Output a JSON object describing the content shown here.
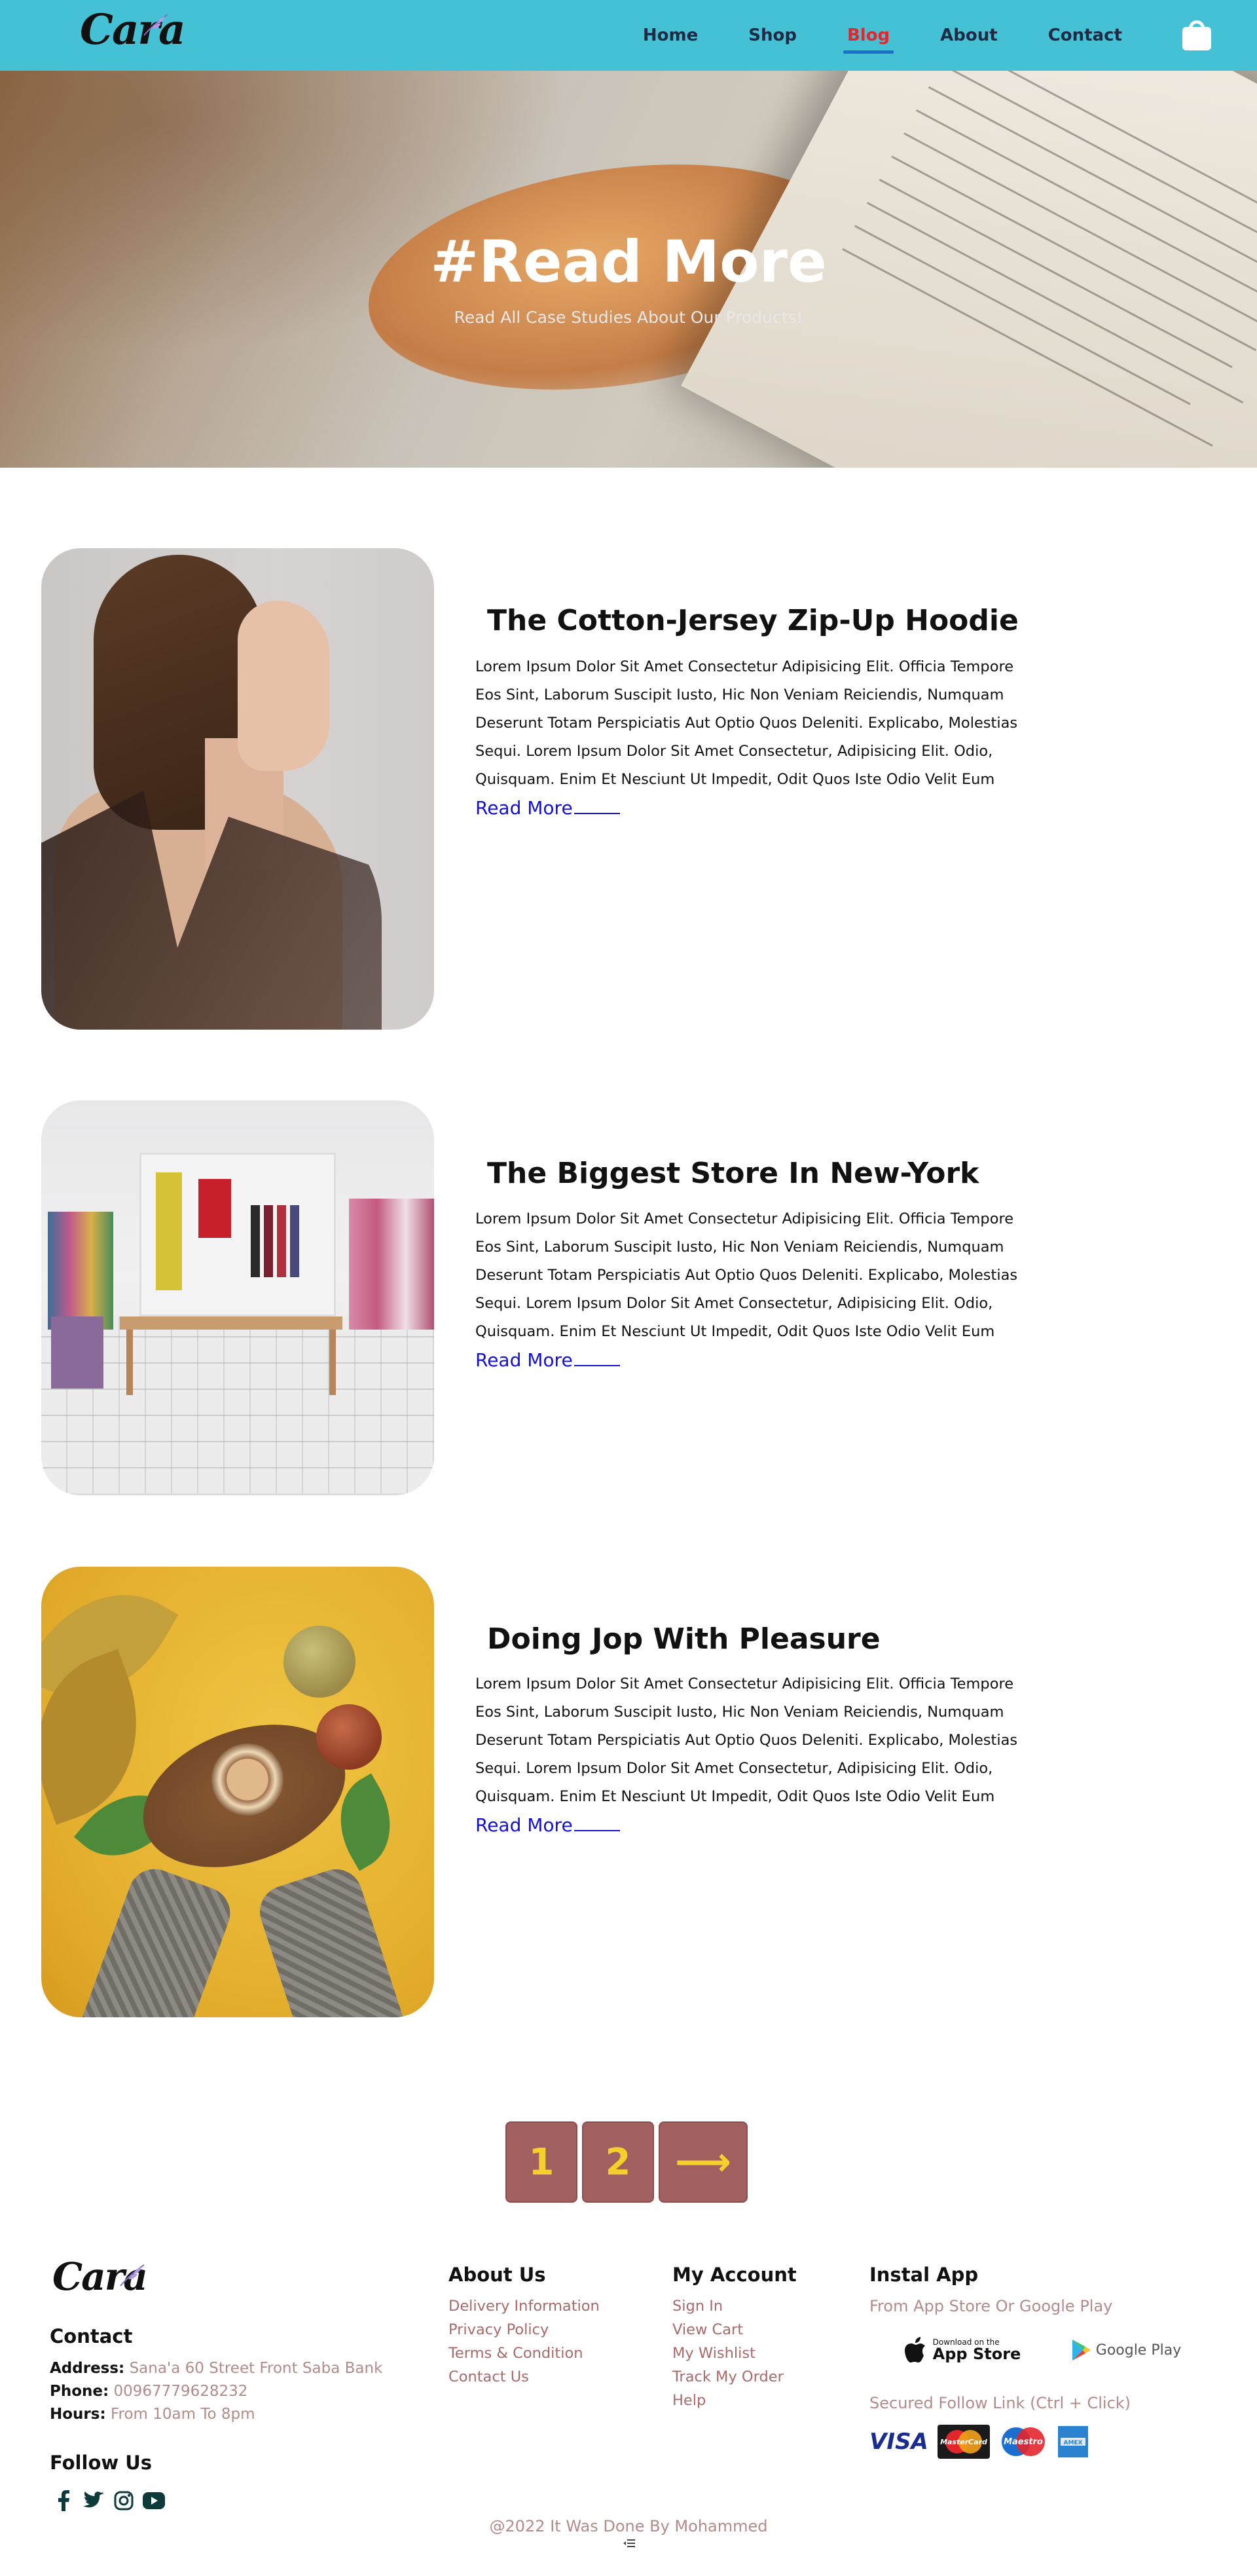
{
  "header": {
    "logo_text": "Cara",
    "nav": [
      {
        "label": "Home"
      },
      {
        "label": "Shop"
      },
      {
        "label": "Blog",
        "active": true
      },
      {
        "label": "About"
      },
      {
        "label": "Contact"
      }
    ],
    "cart_icon": "shopping-bag-icon",
    "colors": {
      "bar": "#45c1d5",
      "active": "#e3262b",
      "underline": "#1e6fc9"
    }
  },
  "hero": {
    "title": "#Read More",
    "subtitle": "Read All Case Studies About Our Products!"
  },
  "posts": [
    {
      "title": "The Cotton-Jersey Zip-Up Hoodie",
      "body": "Lorem Ipsum Dolor Sit Amet Consectetur Adipisicing Elit. Officia Tempore Eos Sint, Laborum Suscipit Iusto, Hic Non Veniam Reiciendis, Numquam Deserunt Totam Perspiciatis Aut Optio Quos Deleniti. Explicabo, Molestias Sequi. Lorem Ipsum Dolor Sit Amet Consectetur, Adipisicing Elit. Odio, Quisquam. Enim Et Nesciunt Ut Impedit, Odit Quos Iste Odio Velit Eum",
      "link": "Read More"
    },
    {
      "title": "The Biggest Store In New-York",
      "body": "Lorem Ipsum Dolor Sit Amet Consectetur Adipisicing Elit. Officia Tempore Eos Sint, Laborum Suscipit Iusto, Hic Non Veniam Reiciendis, Numquam Deserunt Totam Perspiciatis Aut Optio Quos Deleniti. Explicabo, Molestias Sequi. Lorem Ipsum Dolor Sit Amet Consectetur, Adipisicing Elit. Odio, Quisquam. Enim Et Nesciunt Ut Impedit, Odit Quos Iste Odio Velit Eum",
      "link": "Read More"
    },
    {
      "title": "Doing Jop With Pleasure",
      "body": "Lorem Ipsum Dolor Sit Amet Consectetur Adipisicing Elit. Officia Tempore Eos Sint, Laborum Suscipit Iusto, Hic Non Veniam Reiciendis, Numquam Deserunt Totam Perspiciatis Aut Optio Quos Deleniti. Explicabo, Molestias Sequi. Lorem Ipsum Dolor Sit Amet Consectetur, Adipisicing Elit. Odio, Quisquam. Enim Et Nesciunt Ut Impedit, Odit Quos Iste Odio Velit Eum",
      "link": "Read More"
    }
  ],
  "pagination": {
    "pages": [
      "1",
      "2"
    ],
    "next": "⟶",
    "colors": {
      "bg": "#a1605f",
      "text": "#f4d02a"
    }
  },
  "footer": {
    "logo_text": "Cara",
    "contact": {
      "heading": "Contact",
      "address_label": "Address:",
      "address_value": "Sana'a 60 Street Front Saba Bank",
      "phone_label": "Phone:",
      "phone_value": "00967779628232",
      "hours_label": "Hours:",
      "hours_value": "From 10am To 8pm"
    },
    "follow": {
      "heading": "Follow Us",
      "icons": [
        "facebook-icon",
        "twitter-icon",
        "instagram-icon",
        "youtube-icon"
      ]
    },
    "about": {
      "heading": "About Us",
      "links": [
        "Delivery Information",
        "Privacy Policy",
        "Terms & Condition",
        "Contact Us"
      ]
    },
    "account": {
      "heading": "My Account",
      "links": [
        "Sign In",
        "View Cart",
        "My Wishlist",
        "Track My Order",
        "Help"
      ]
    },
    "app": {
      "heading": "Instal App",
      "subtitle": "From App Store Or Google Play",
      "app_store_small": "Download on the",
      "app_store_big": "App Store",
      "google_play": "Google Play",
      "secured": "Secured Follow Link (Ctrl + Click)",
      "payments": [
        "VISA",
        "MasterCard",
        "Maestro",
        "AMEX"
      ]
    },
    "copyright": "@2022 It Was Done By Mohammed"
  }
}
